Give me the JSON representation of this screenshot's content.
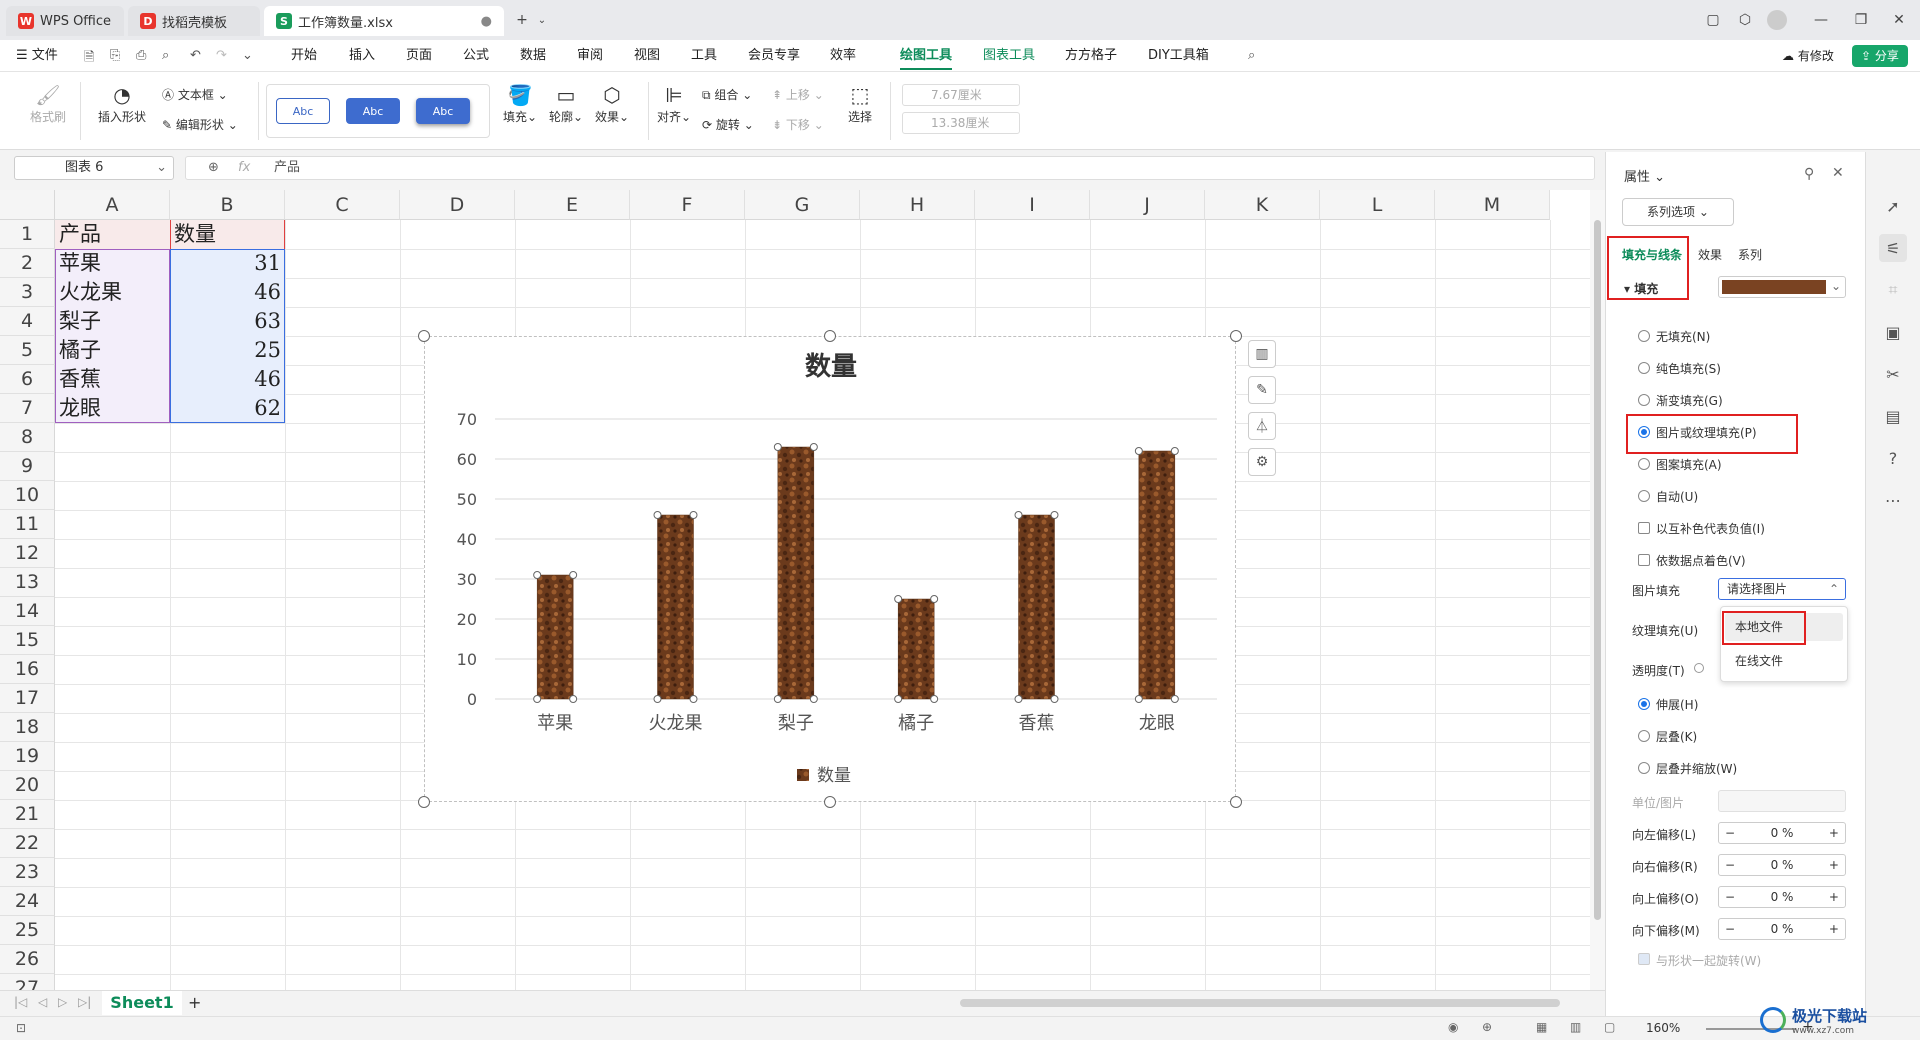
{
  "tabs": [
    {
      "label": "WPS Office"
    },
    {
      "label": "找稻壳模板"
    },
    {
      "label": "工作簿数量.xlsx"
    }
  ],
  "menu": {
    "file": "文件",
    "items": [
      "开始",
      "插入",
      "页面",
      "公式",
      "数据",
      "审阅",
      "视图",
      "工具",
      "会员专享",
      "效率",
      "绘图工具",
      "图表工具",
      "方方格子",
      "DIY工具箱"
    ],
    "modify": "有修改",
    "share": "分享"
  },
  "ribbon": {
    "format_painter": "格式刷",
    "insert_shape": "插入形状",
    "text_box": "文本框",
    "edit_shape": "编辑形状",
    "style_abc": "Abc",
    "fill": "填充",
    "outline": "轮廓",
    "effect": "效果",
    "align": "对齐",
    "group": "组合",
    "rotate": "旋转",
    "move_up": "上移",
    "move_down": "下移",
    "select": "选择",
    "width": "7.67厘米",
    "height": "13.38厘米"
  },
  "formula": {
    "namebox": "图表 6",
    "fx": "fx",
    "content": "产品"
  },
  "sheet": {
    "columns": [
      "A",
      "B",
      "C",
      "D",
      "E",
      "F",
      "G",
      "H",
      "I",
      "J",
      "K",
      "L",
      "M"
    ],
    "rows": [
      "1",
      "2",
      "3",
      "4",
      "5",
      "6",
      "7",
      "8",
      "9",
      "10",
      "11",
      "12",
      "13",
      "14",
      "15",
      "16",
      "17",
      "18",
      "19",
      "20",
      "21",
      "22",
      "23",
      "24",
      "25",
      "26",
      "27"
    ],
    "header": [
      "产品",
      "数量"
    ],
    "data": [
      [
        "苹果",
        "31"
      ],
      [
        "火龙果",
        "46"
      ],
      [
        "梨子",
        "63"
      ],
      [
        "橘子",
        "25"
      ],
      [
        "香蕉",
        "46"
      ],
      [
        "龙眼",
        "62"
      ]
    ],
    "tab": "Sheet1",
    "add": "+"
  },
  "chart_data": {
    "type": "bar",
    "title": "数量",
    "categories": [
      "苹果",
      "火龙果",
      "梨子",
      "橘子",
      "香蕉",
      "龙眼"
    ],
    "series": [
      {
        "name": "数量",
        "values": [
          31,
          46,
          63,
          25,
          46,
          62
        ]
      }
    ],
    "ylim": [
      0,
      70
    ],
    "yticks": [
      "0",
      "10",
      "20",
      "30",
      "40",
      "50",
      "60",
      "70"
    ],
    "grid": true,
    "legend": "bottom",
    "bar_color": "#6b3a1c"
  },
  "panel": {
    "title": "属性",
    "series_options": "系列选项",
    "tabs": [
      "填充与线条",
      "效果",
      "系列"
    ],
    "fill_section": "填充",
    "options": [
      "无填充(N)",
      "纯色填充(S)",
      "渐变填充(G)",
      "图片或纹理填充(P)",
      "图案填充(A)",
      "自动(U)"
    ],
    "checks": [
      "以互补色代表负值(I)",
      "依数据点着色(V)"
    ],
    "picture_fill_label": "图片填充",
    "picture_fill_value": "请选择图片",
    "dropdown": [
      "本地文件",
      "在线文件"
    ],
    "texture_label": "纹理填充(U)",
    "transparency_label": "透明度(T)",
    "stretch": [
      "伸展(H)",
      "层叠(K)",
      "层叠并缩放(W)"
    ],
    "unit_label": "单位/图片",
    "offsets": [
      {
        "label": "向左偏移(L)",
        "value": "0 %"
      },
      {
        "label": "向右偏移(R)",
        "value": "0 %"
      },
      {
        "label": "向上偏移(O)",
        "value": "0 %"
      },
      {
        "label": "向下偏移(M)",
        "value": "0 %"
      }
    ],
    "rotate_with_shape": "与形状一起旋转(W)"
  },
  "status": {
    "zoom": "160%",
    "watermark": "极光下载站",
    "watermark_url": "www.xz7.com"
  }
}
